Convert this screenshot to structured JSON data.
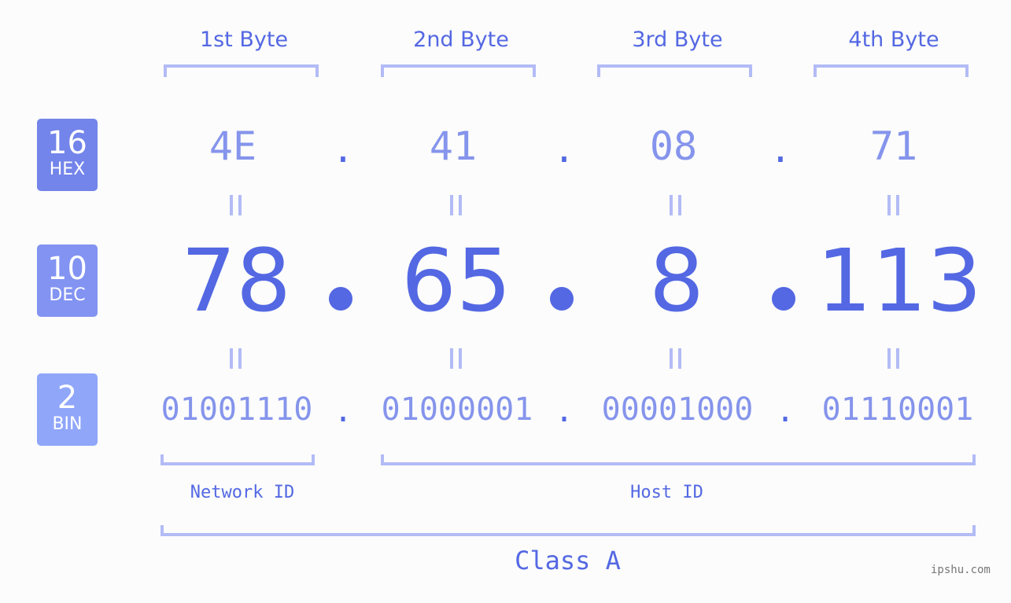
{
  "badges": {
    "hex": {
      "number": "16",
      "label": "HEX",
      "color": "#7384ea"
    },
    "dec": {
      "number": "10",
      "label": "DEC",
      "color": "#8293f2"
    },
    "bin": {
      "number": "2",
      "label": "BIN",
      "color": "#8fa6f9"
    }
  },
  "bytes": [
    {
      "heading": "1st Byte",
      "hex": "4E",
      "dec": "78",
      "bin": "01001110"
    },
    {
      "heading": "2nd Byte",
      "hex": "41",
      "dec": "65",
      "bin": "01000001"
    },
    {
      "heading": "3rd Byte",
      "hex": "08",
      "dec": "8",
      "bin": "00001000"
    },
    {
      "heading": "4th Byte",
      "hex": "71",
      "dec": "113",
      "bin": "01110001"
    }
  ],
  "separator": ".",
  "equals_symbol": "||",
  "network_id_label": "Network ID",
  "host_id_label": "Host ID",
  "class_label": "Class A",
  "watermark": "ipshu.com",
  "colors": {
    "primary": "#5468e3",
    "light": "#8594ec",
    "bracket": "#b3bbf6",
    "background": "#fbfcfb"
  }
}
